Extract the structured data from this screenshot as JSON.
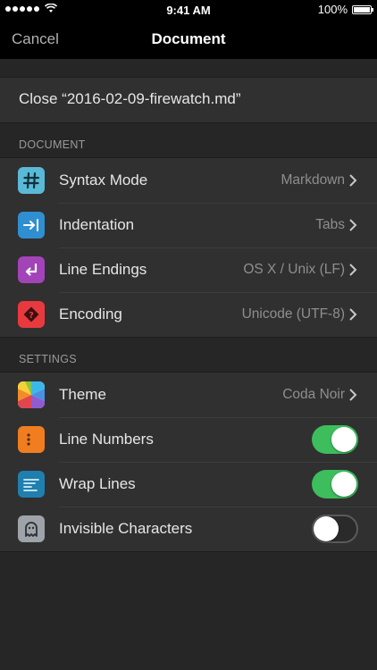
{
  "status_bar": {
    "time": "9:41 AM",
    "battery": "100%"
  },
  "nav": {
    "cancel": "Cancel",
    "title": "Document"
  },
  "close_action": "Close “2016-02-09-firewatch.md”",
  "document_section": {
    "header": "DOCUMENT",
    "rows": [
      {
        "label": "Syntax Mode",
        "value": "Markdown",
        "icon": "hash-icon",
        "color": "#5ab9d6"
      },
      {
        "label": "Indentation",
        "value": "Tabs",
        "icon": "tab-indent-icon",
        "color": "#2f8fd0"
      },
      {
        "label": "Line Endings",
        "value": "OS X / Unix (LF)",
        "icon": "return-arrow-icon",
        "color": "#a243b8"
      },
      {
        "label": "Encoding",
        "value": "Unicode (UTF-8)",
        "icon": "encoding-icon",
        "color": "#e83a3e"
      }
    ]
  },
  "settings_section": {
    "header": "SETTINGS",
    "rows": [
      {
        "label": "Theme",
        "value": "Coda Noir",
        "icon": "color-wheel-icon"
      },
      {
        "label": "Line Numbers",
        "toggle": true,
        "icon": "line-numbers-icon",
        "color": "#f07d1f"
      },
      {
        "label": "Wrap Lines",
        "toggle": true,
        "icon": "wrap-lines-icon",
        "color": "#1f7fae"
      },
      {
        "label": "Invisible Characters",
        "toggle": false,
        "icon": "ghost-icon",
        "color": "#9da3a8"
      }
    ]
  }
}
